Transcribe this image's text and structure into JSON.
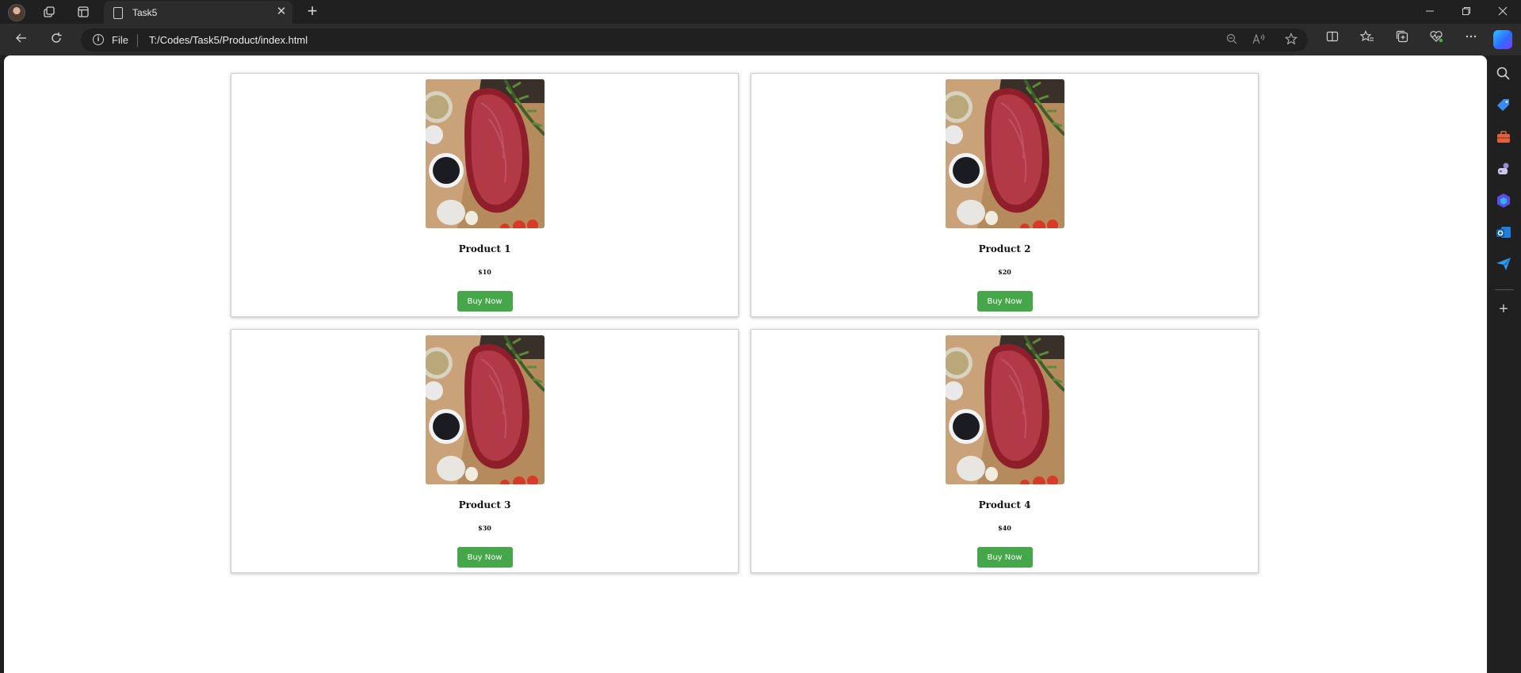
{
  "browser": {
    "tab_title": "Task5",
    "close_tab_glyph": "✕",
    "new_tab_glyph": "+",
    "address_scheme_label": "File",
    "address_url": "T:/Codes/Task5/Product/index.html",
    "window_controls": [
      "minimize",
      "restore",
      "close"
    ],
    "sidebar_icons": [
      "search-icon",
      "shopping-tag-icon",
      "tools-icon",
      "games-icon",
      "copilot-icon",
      "outlook-icon",
      "send-icon",
      "add-icon"
    ]
  },
  "page": {
    "products": [
      {
        "name": "Product 1",
        "price": "$10",
        "button": "Buy Now"
      },
      {
        "name": "Product 2",
        "price": "$20",
        "button": "Buy Now"
      },
      {
        "name": "Product 3",
        "price": "$30",
        "button": "Buy Now"
      },
      {
        "name": "Product 4",
        "price": "$40",
        "button": "Buy Now"
      }
    ]
  },
  "colors": {
    "buy_button": "#45a64a",
    "browser_chrome": "#202020",
    "tab_active": "#2c2c2c"
  }
}
